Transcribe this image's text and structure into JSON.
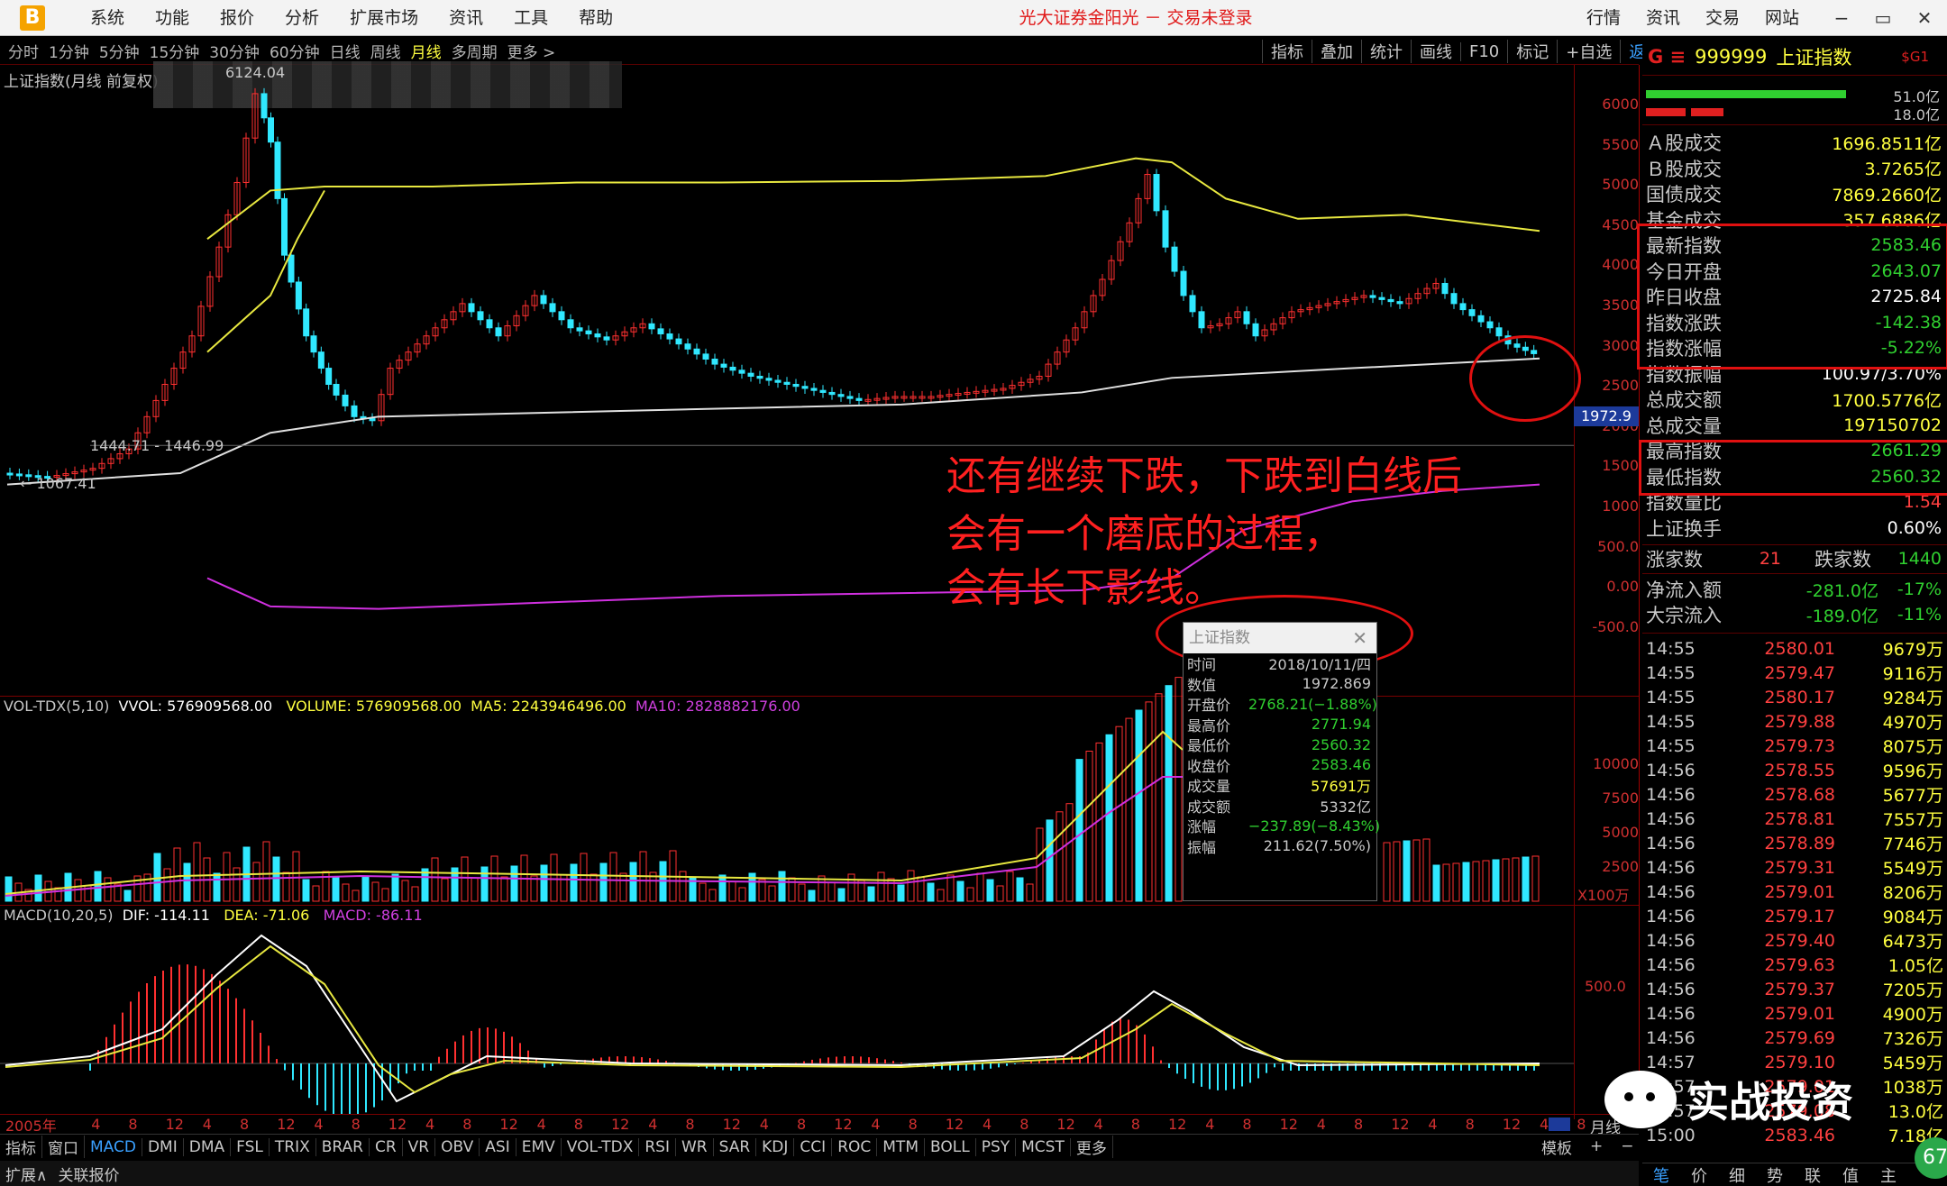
{
  "window": {
    "logo": "B",
    "menu": [
      "系统",
      "功能",
      "报价",
      "分析",
      "扩展市场",
      "资讯",
      "工具",
      "帮助"
    ],
    "title": "光大证券金阳光 － 交易未登录",
    "right_menu": [
      "行情",
      "资讯",
      "交易",
      "网站"
    ],
    "win_buttons": [
      "−",
      "▭",
      "✕"
    ]
  },
  "periods": [
    "分时",
    "1分钟",
    "5分钟",
    "15分钟",
    "30分钟",
    "60分钟",
    "日线",
    "周线",
    "月线",
    "多周期",
    "更多 >"
  ],
  "active_period": "月线",
  "tools": [
    "指标",
    "叠加",
    "统计",
    "画线",
    "F10",
    "标记",
    "+自选",
    "返回"
  ],
  "chart_title": "上证指数(月线 前复权)",
  "main_axis": [
    "6000",
    "5500",
    "5000",
    "4500",
    "4000",
    "3500",
    "3000",
    "2500",
    "2000",
    "1500",
    "1000",
    "500.0",
    "0.00",
    "-500.0"
  ],
  "price_tag": "1972.9",
  "peak_label": "6124.04",
  "low_label": "1067.41",
  "range_label": "1444.71 - 1446.99",
  "vol_indicator": {
    "name": "VOL-TDX(5,10)",
    "vvol": "VVOL: 576909568.00",
    "volume": "VOLUME: 576909568.00",
    "ma5": "MA5: 2243946496.00",
    "ma10": "MA10: 2828882176.00"
  },
  "vol_axis": [
    "10000",
    "7500",
    "5000",
    "2500"
  ],
  "vol_unit": "X100万",
  "macd_indicator": {
    "name": "MACD(10,20,5)",
    "dif": "DIF: -114.11",
    "dea": "DEA: -71.06",
    "macd": "MACD: -86.11"
  },
  "macd_axis": [
    "500.0"
  ],
  "dates": [
    "2005年",
    "4",
    "8",
    "12",
    "4",
    "8",
    "12",
    "4",
    "8",
    "12",
    "4",
    "8",
    "12",
    "4",
    "8",
    "12",
    "4",
    "8",
    "12",
    "4",
    "8",
    "12",
    "4",
    "8",
    "12",
    "4",
    "8",
    "12",
    "4",
    "8",
    "12",
    "4",
    "8",
    "12",
    "4",
    "8",
    "12",
    "4",
    "8",
    "12",
    "4",
    "8"
  ],
  "date_mode": "月线",
  "indicators_bar": [
    "指标",
    "窗口",
    "MACD",
    "DMI",
    "DMA",
    "FSL",
    "TRIX",
    "BRAR",
    "CR",
    "VR",
    "OBV",
    "ASI",
    "EMV",
    "VOL-TDX",
    "RSI",
    "WR",
    "SAR",
    "KDJ",
    "CCI",
    "ROC",
    "MTM",
    "BOLL",
    "PSY",
    "MCST",
    "更多"
  ],
  "active_indicator": "MACD",
  "bottom_right": [
    "模板",
    "+",
    "−"
  ],
  "status": [
    "扩展∧",
    "关联报价"
  ],
  "annotation": [
    "还有继续下跌，下跌到白线后",
    "会有一个磨底的过程，",
    "会有长下影线。"
  ],
  "popup": {
    "title": "上证指数",
    "rows": [
      {
        "k": "时间",
        "v": "2018/10/11/四",
        "c": "#c8c8c8"
      },
      {
        "k": "数值",
        "v": "1972.869",
        "c": "#c8c8c8"
      },
      {
        "k": "开盘价",
        "v": "2768.21(−1.88%)",
        "c": "#30d030"
      },
      {
        "k": "最高价",
        "v": "2771.94",
        "c": "#30d030"
      },
      {
        "k": "最低价",
        "v": "2560.32",
        "c": "#30d030"
      },
      {
        "k": "收盘价",
        "v": "2583.46",
        "c": "#30d030"
      },
      {
        "k": "成交量",
        "v": "57691万",
        "c": "#ffff40"
      },
      {
        "k": "成交额",
        "v": "5332亿",
        "c": "#c8c8c8"
      },
      {
        "k": "涨幅",
        "v": "−237.89(−8.43%)",
        "c": "#30d030"
      },
      {
        "k": "振幅",
        "v": "211.62(7.50%)",
        "c": "#c8c8c8"
      }
    ]
  },
  "right_panel": {
    "prefix": "G ≡",
    "code": "999999",
    "name": "上证指数",
    "sg": "$G1",
    "bar1": "51.0亿",
    "bar2": "18.0亿",
    "stats": [
      {
        "k": "Ａ股成交",
        "v": "1696.8511亿",
        "c": "#ffff40"
      },
      {
        "k": "Ｂ股成交",
        "v": "3.7265亿",
        "c": "#ffff40"
      },
      {
        "k": "国债成交",
        "v": "7869.2660亿",
        "c": "#ffff40"
      },
      {
        "k": "基金成交",
        "v": "357.6886亿",
        "c": "#ffff40"
      },
      {
        "k": "最新指数",
        "v": "2583.46",
        "c": "#30d030"
      },
      {
        "k": "今日开盘",
        "v": "2643.07",
        "c": "#30d030"
      },
      {
        "k": "昨日收盘",
        "v": "2725.84",
        "c": "#ffffff"
      },
      {
        "k": "指数涨跌",
        "v": "-142.38",
        "c": "#30d030"
      },
      {
        "k": "指数涨幅",
        "v": "-5.22%",
        "c": "#30d030"
      },
      {
        "k": "指数振幅",
        "v": "100.97/3.70%",
        "c": "#ffffff"
      },
      {
        "k": "总成交额",
        "v": "1700.5776亿",
        "c": "#ffff40"
      },
      {
        "k": "总成交量",
        "v": "197150702",
        "c": "#ffff40"
      },
      {
        "k": "最高指数",
        "v": "2661.29",
        "c": "#30d030"
      },
      {
        "k": "最低指数",
        "v": "2560.32",
        "c": "#30d030"
      },
      {
        "k": "指数量比",
        "v": "1.54",
        "c": "#ff4040"
      },
      {
        "k": "上证换手",
        "v": "0.60%",
        "c": "#ffffff"
      }
    ],
    "up_label": "涨家数",
    "up_val": "21",
    "down_label": "跌家数",
    "down_val": "1440",
    "flows": [
      {
        "k": "净流入额",
        "v": "-281.0亿",
        "p": "-17%"
      },
      {
        "k": "大宗流入",
        "v": "-189.0亿",
        "p": "-11%"
      }
    ],
    "ticks": [
      {
        "t": "14:55",
        "p": "2580.01",
        "q": "9679万"
      },
      {
        "t": "14:55",
        "p": "2579.47",
        "q": "9116万"
      },
      {
        "t": "14:55",
        "p": "2580.17",
        "q": "9284万"
      },
      {
        "t": "14:55",
        "p": "2579.88",
        "q": "4970万"
      },
      {
        "t": "14:55",
        "p": "2579.73",
        "q": "8075万"
      },
      {
        "t": "14:56",
        "p": "2578.55",
        "q": "9596万"
      },
      {
        "t": "14:56",
        "p": "2578.68",
        "q": "5677万"
      },
      {
        "t": "14:56",
        "p": "2578.81",
        "q": "7557万"
      },
      {
        "t": "14:56",
        "p": "2578.89",
        "q": "7746万"
      },
      {
        "t": "14:56",
        "p": "2579.31",
        "q": "5549万"
      },
      {
        "t": "14:56",
        "p": "2579.01",
        "q": "8206万"
      },
      {
        "t": "14:56",
        "p": "2579.17",
        "q": "9084万"
      },
      {
        "t": "14:56",
        "p": "2579.40",
        "q": "6473万"
      },
      {
        "t": "14:56",
        "p": "2579.63",
        "q": "1.05亿"
      },
      {
        "t": "14:56",
        "p": "2579.37",
        "q": "7205万"
      },
      {
        "t": "14:56",
        "p": "2579.01",
        "q": "4900万"
      },
      {
        "t": "14:56",
        "p": "2579.69",
        "q": "7326万"
      },
      {
        "t": "14:57",
        "p": "2579.10",
        "q": "5459万"
      },
      {
        "t": "14:57",
        "p": "2579.01",
        "q": "1038万"
      },
      {
        "t": "14:57",
        "p": "2579.08",
        "q": "13.0亿"
      },
      {
        "t": "15:00",
        "p": "2583.46",
        "q": "7.18亿"
      }
    ],
    "bottom_tabs": [
      "笔",
      "价",
      "细",
      "势",
      "联",
      "值",
      "主"
    ]
  },
  "watermark": "实战投资",
  "badge": "67",
  "colors": {
    "up": "#ff3030",
    "down": "#30e8ff",
    "ma1": "#e8e840",
    "ma2": "#e0e0e0",
    "ma3": "#d030e0",
    "accent_red": "#e01010"
  }
}
